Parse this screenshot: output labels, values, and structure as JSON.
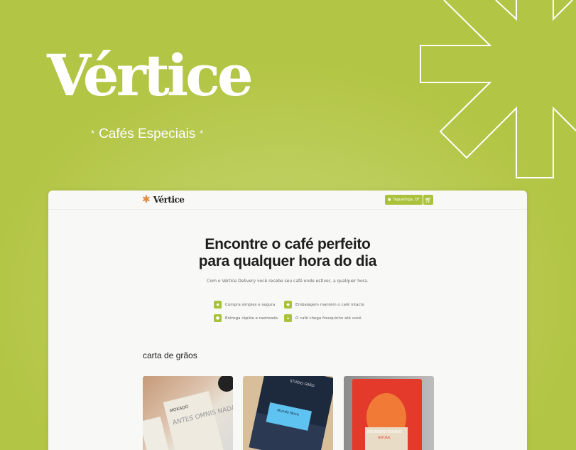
{
  "hero": {
    "title": "Vértice",
    "subtitle": "Cafés Especiais",
    "star": "*"
  },
  "nav": {
    "brand": "Vértice",
    "location": "Taguatinga, DF",
    "cart_icon": "cart-icon",
    "location_icon": "pin-icon"
  },
  "main": {
    "headline_1": "Encontre o café perfeito",
    "headline_2": "para qualquer hora do dia",
    "lead": "Com o Vértice Delivery você recebe seu café onde estiver, a qualquer hora.",
    "features": [
      {
        "label": "Compra simples e segura",
        "icon": "cart-icon"
      },
      {
        "label": "Embalagem mantém o café intacto",
        "icon": "package-icon"
      },
      {
        "label": "Entrega rápida e rastreada",
        "icon": "truck-icon"
      },
      {
        "label": "O café chega fresquinho até você",
        "icon": "bag-icon"
      }
    ],
    "section_title": "carta de grãos",
    "products": [
      {
        "brand": "MOKADO",
        "text": "ANTES OMNIS NADA,"
      },
      {
        "brand": "STUDIO GRÃO",
        "text": "Mundo Novo"
      },
      {
        "brand": "BOURBON ROSADO",
        "text": "NATURAL"
      }
    ]
  },
  "colors": {
    "accent": "#a9c23b",
    "background": "#b3c544",
    "logo_mark": "#e08a3c"
  }
}
